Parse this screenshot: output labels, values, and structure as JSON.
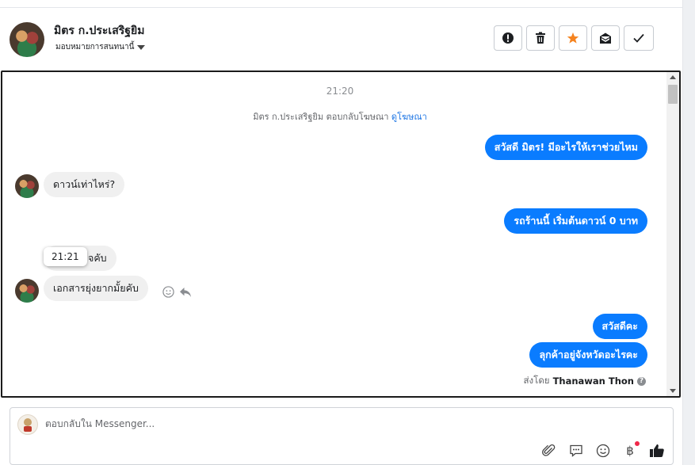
{
  "header": {
    "contact_name": "มิตร ก.ประเสริฐยิม",
    "assign_label": "มอบหมายการสนทนานี้"
  },
  "actions": [
    {
      "name": "spam-button",
      "icon": "alert-icon"
    },
    {
      "name": "delete-button",
      "icon": "trash-icon"
    },
    {
      "name": "star-button",
      "icon": "star-icon"
    },
    {
      "name": "mark-unread-button",
      "icon": "envelope-icon"
    },
    {
      "name": "done-button",
      "icon": "check-icon"
    }
  ],
  "chat": {
    "time_1": "21:20",
    "notice_text": "มิตร ก.ประเสริฐยิม ตอบกลับโฆษณา ",
    "notice_link": "ดูโฆษณา",
    "messages": [
      {
        "dir": "out",
        "text": "สวัสดี มิตร! มีอะไรให้เราช่วยไหม"
      },
      {
        "dir": "in",
        "text": "ดาวน์เท่าไหร่?"
      },
      {
        "dir": "out",
        "text": "รถร้านนี้ เริ่มต้นดาวน์ 0 บาท"
      },
      {
        "dir": "in",
        "text": "จคับ"
      },
      {
        "dir": "in",
        "text": "เอกสารยุ่งยากมั้ยคับ"
      },
      {
        "dir": "out",
        "text": "สวัสดีคะ"
      },
      {
        "dir": "out",
        "text": "ลุกค้าอยู่จังหวัดอะไรคะ"
      }
    ],
    "tooltip_time": "21:21",
    "sent_by_label": "ส่งโดย",
    "sent_by_name": "Thanawan Thon"
  },
  "composer": {
    "placeholder": "ตอบกลับใน Messenger..."
  },
  "colors": {
    "outgoing_bubble": "#0a7cff",
    "incoming_bubble": "#f0f0f0",
    "star": "#f5831f",
    "notification_dot": "#f02849"
  }
}
